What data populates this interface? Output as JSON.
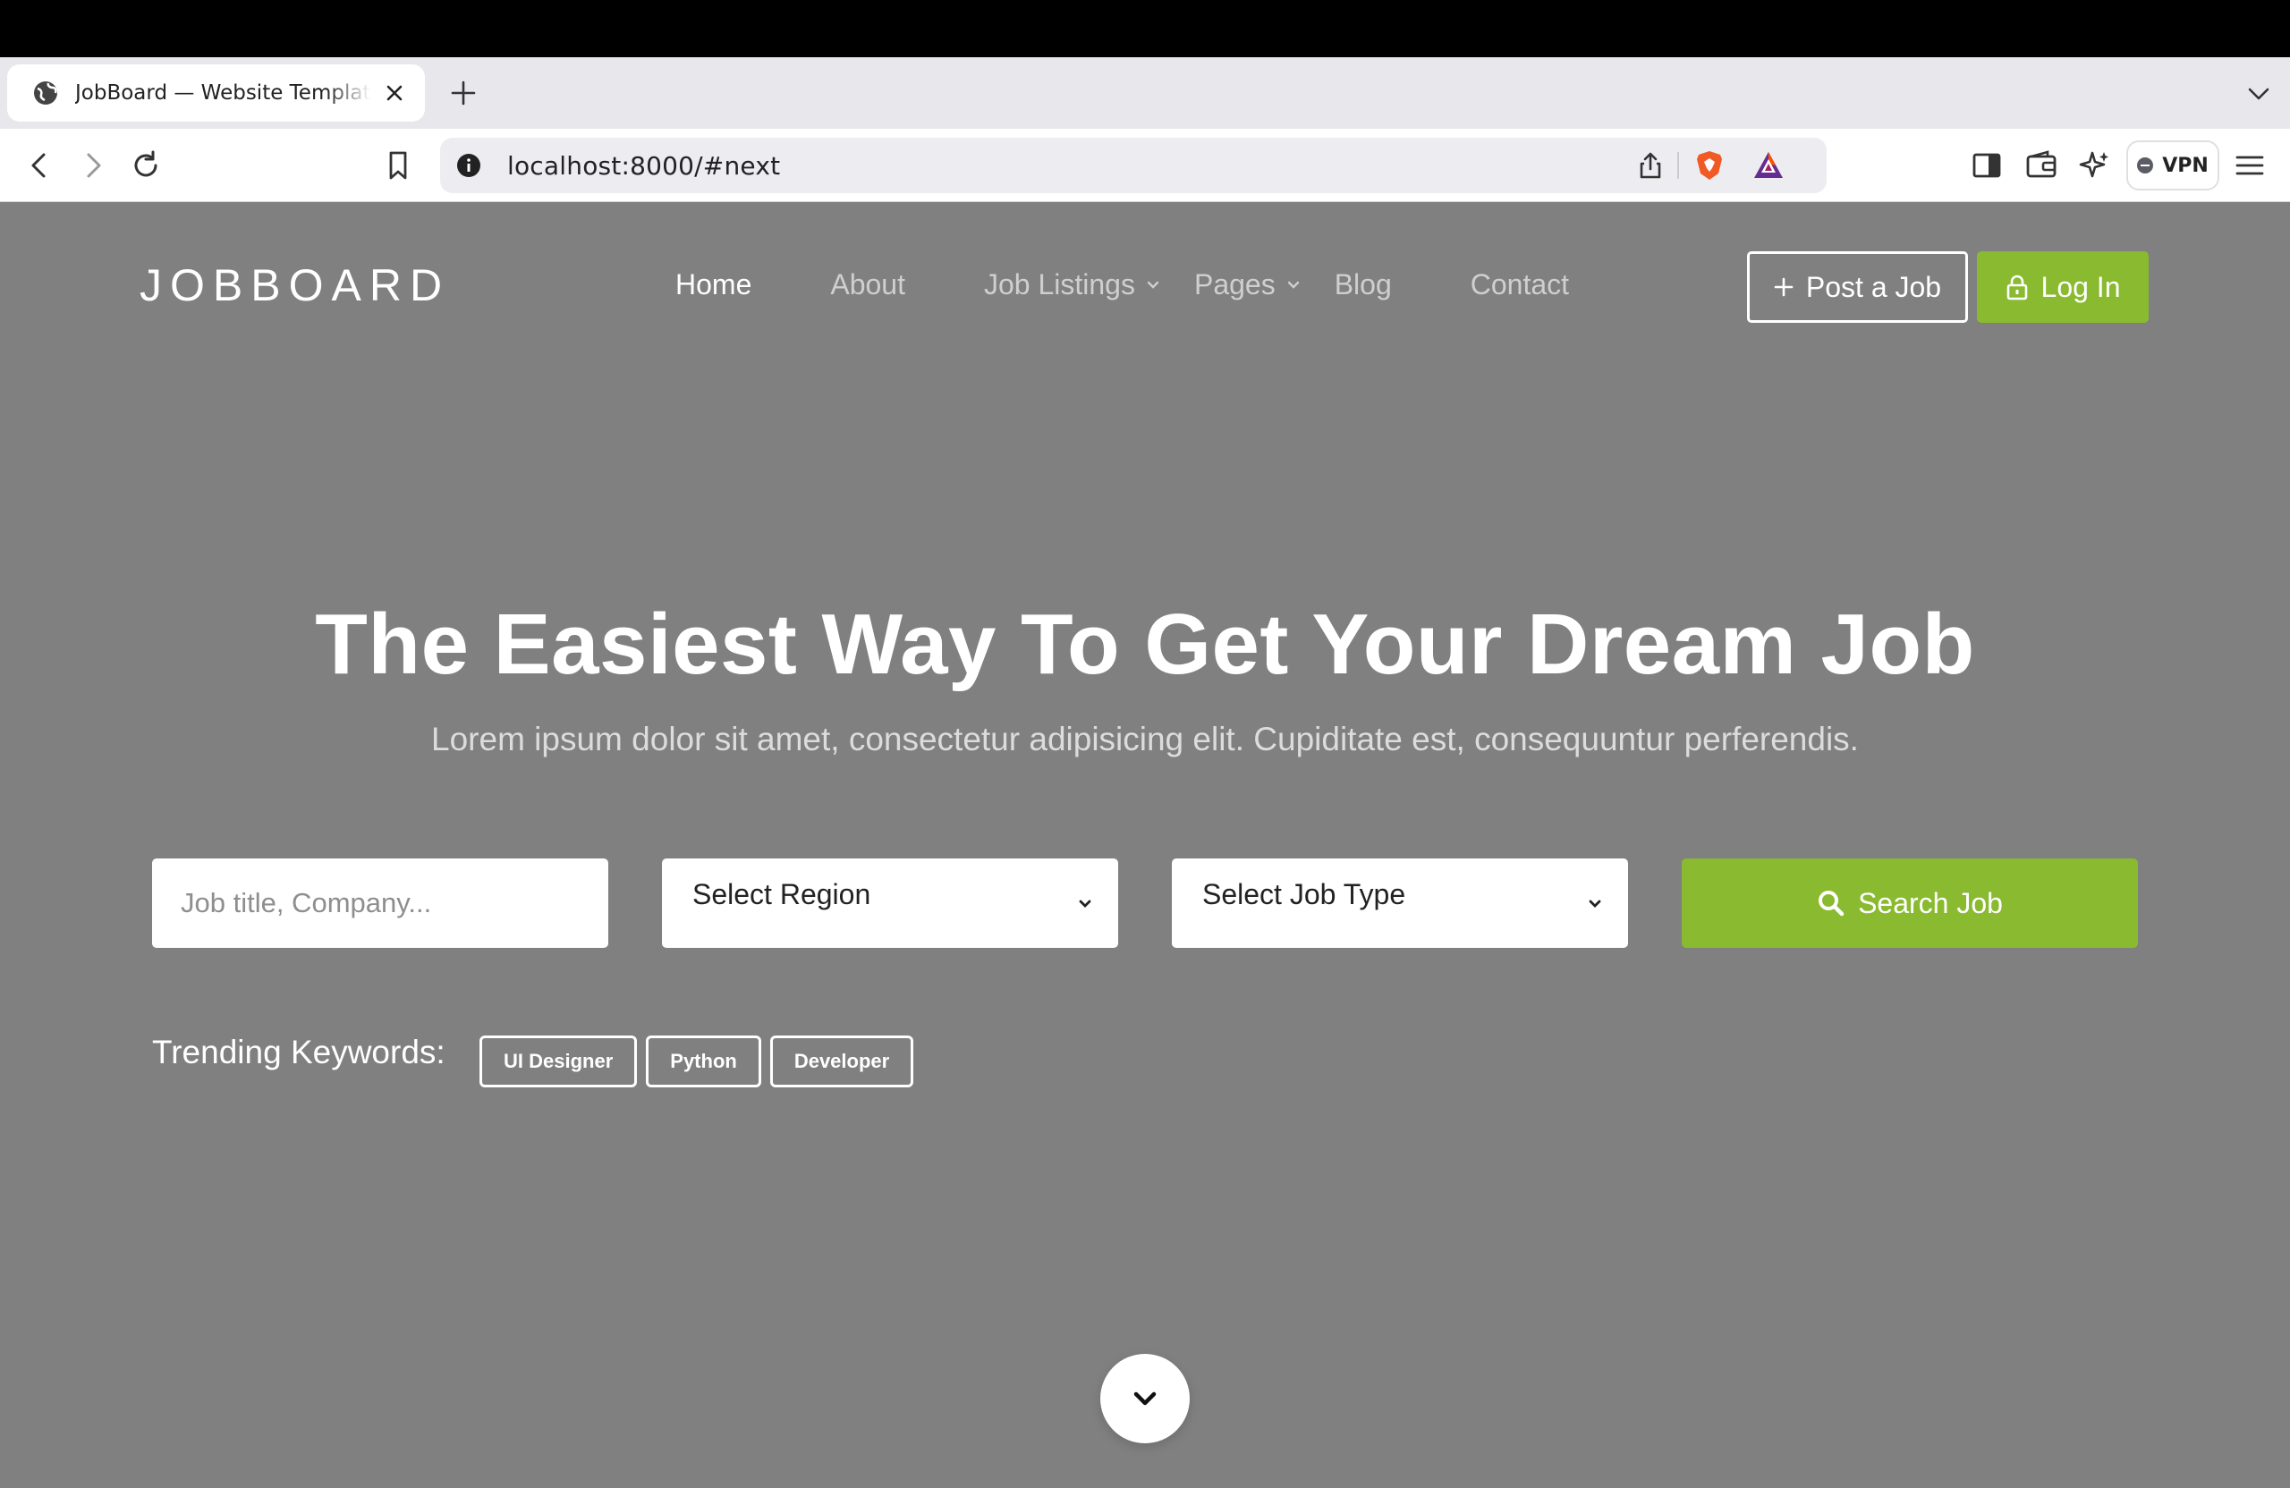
{
  "browser": {
    "tab_title": "JobBoard — Website Template",
    "url": "localhost:8000/#next",
    "vpn_label": "VPN"
  },
  "site": {
    "logo": "JOBBOARD",
    "nav": [
      {
        "label": "Home",
        "active": true,
        "dropdown": false
      },
      {
        "label": "About",
        "active": false,
        "dropdown": false
      },
      {
        "label": "Job Listings",
        "active": false,
        "dropdown": true
      },
      {
        "label": "Pages",
        "active": false,
        "dropdown": true
      },
      {
        "label": "Blog",
        "active": false,
        "dropdown": false
      },
      {
        "label": "Contact",
        "active": false,
        "dropdown": false
      }
    ],
    "post_job_label": "Post a Job",
    "login_label": "Log In"
  },
  "hero": {
    "title": "The Easiest Way To Get Your Dream Job",
    "subtitle": "Lorem ipsum dolor sit amet, consectetur adipisicing elit. Cupiditate est, consequuntur perferendis."
  },
  "search": {
    "keyword_placeholder": "Job title, Company...",
    "region_selected": "Select Region",
    "job_type_selected": "Select Job Type",
    "button_label": "Search Job"
  },
  "trending": {
    "label": "Trending Keywords:",
    "keywords": [
      "UI Designer",
      "Python",
      "Developer"
    ]
  },
  "colors": {
    "accent": "#89ba2f",
    "hero_overlay": "#808080"
  }
}
